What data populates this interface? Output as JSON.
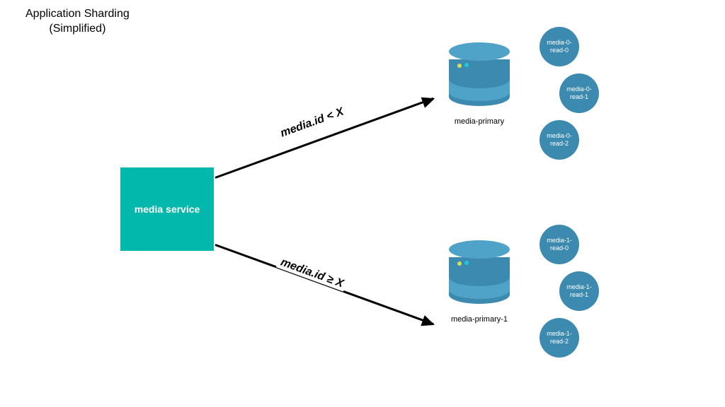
{
  "title_line1": "Application Sharding",
  "title_line2": "(Simplified)",
  "service": {
    "label": "media service"
  },
  "edges": {
    "top": "media.id < X",
    "bottom": "media.id ≥ X"
  },
  "shards": {
    "top": {
      "primary_label": "media-primary",
      "replicas": [
        "media-0-read-0",
        "media-0-read-1",
        "media-0-read-2"
      ]
    },
    "bottom": {
      "primary_label": "media-primary-1",
      "replicas": [
        "media-1-read-0",
        "media-1-read-1",
        "media-1-read-2"
      ]
    }
  },
  "colors": {
    "service_bg": "#02b8ac",
    "db_primary": "#3c8ab0",
    "db_light": "#50a3c8"
  }
}
